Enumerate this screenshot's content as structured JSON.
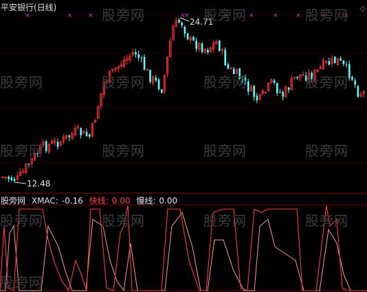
{
  "title": "平安银行(日线)",
  "annotations": {
    "high": "24.71",
    "low": "12.48"
  },
  "indicator": {
    "name": "股旁网",
    "main_label": "XMAC:",
    "main_value": "-0.16",
    "fast_label": "快线:",
    "fast_value": "0.00",
    "slow_label": "慢线:",
    "slow_value": "0.00"
  },
  "watermark": "股旁网",
  "colors": {
    "background": "#000000",
    "up_candle": "#ff3030",
    "down_candle": "#55ffff",
    "grid": "#7a0000",
    "marker": "#cc33cc",
    "fast_line": "#ff3a3a",
    "slow_line": "#ff9999"
  },
  "diamond_icon": "◇"
}
